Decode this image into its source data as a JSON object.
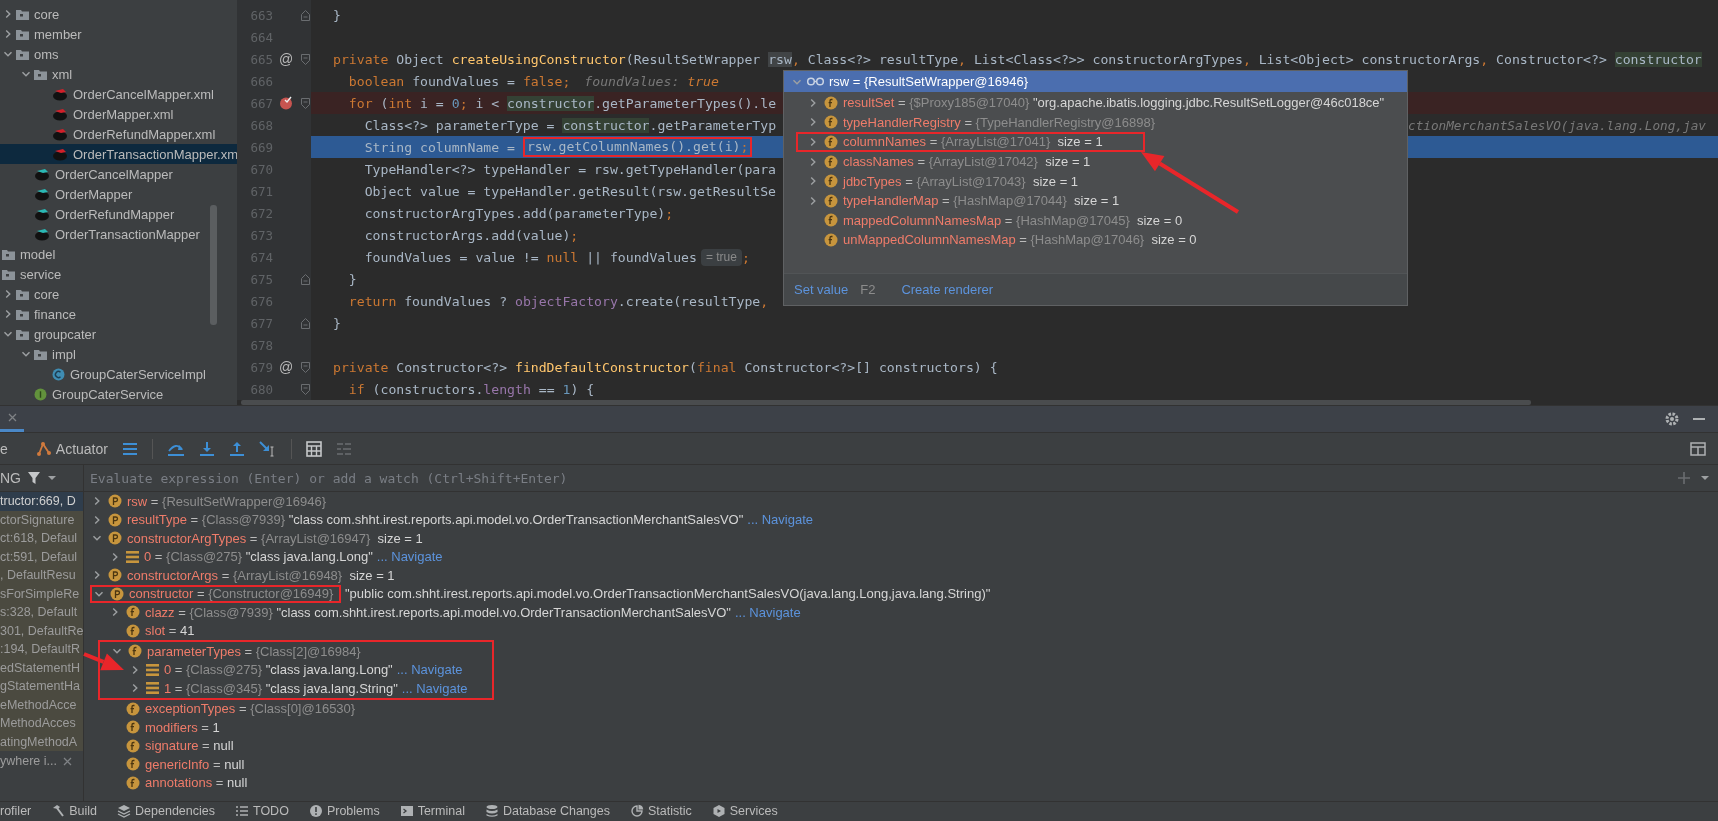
{
  "project_tree": [
    {
      "children": [
        {
          "label": "core",
          "kind": "folder",
          "expanded": false,
          "selected": false
        },
        {
          "label": "member",
          "kind": "folder",
          "expanded": false,
          "selected": false
        },
        {
          "label": "oms",
          "kind": "folder",
          "expanded": true,
          "selected": false,
          "children": [
            {
              "label": "xml",
              "kind": "folder",
              "expanded": true,
              "selected": false,
              "children": [
                {
                  "label": "OrderCancelMapper.xml",
                  "kind": "mapper-xml",
                  "selected": false
                },
                {
                  "label": "OrderMapper.xml",
                  "kind": "mapper-xml",
                  "selected": false
                },
                {
                  "label": "OrderRefundMapper.xml",
                  "kind": "mapper-xml",
                  "selected": false
                },
                {
                  "label": "OrderTransactionMapper.xm",
                  "kind": "mapper-xml",
                  "selected": true
                }
              ]
            },
            {
              "label": "OrderCancelMapper",
              "kind": "mapper",
              "selected": false
            },
            {
              "label": "OrderMapper",
              "kind": "mapper",
              "selected": false
            },
            {
              "label": "OrderRefundMapper",
              "kind": "mapper",
              "selected": false
            },
            {
              "label": "OrderTransactionMapper",
              "kind": "mapper",
              "selected": false
            }
          ]
        }
      ]
    },
    {
      "label": "model",
      "kind": "folder",
      "selected": false
    },
    {
      "label": "service",
      "kind": "folder",
      "selected": false,
      "children": [
        {
          "label": "core",
          "kind": "folder",
          "expanded": false,
          "selected": false
        },
        {
          "label": "finance",
          "kind": "folder",
          "expanded": false,
          "selected": false
        },
        {
          "label": "groupcater",
          "kind": "folder",
          "expanded": true,
          "selected": false,
          "children": [
            {
              "label": "impl",
              "kind": "folder",
              "expanded": true,
              "selected": false,
              "children": [
                {
                  "label": "GroupCaterServiceImpl",
                  "kind": "class",
                  "selected": false
                }
              ]
            },
            {
              "label": "GroupCaterService",
              "kind": "interface",
              "selected": false
            }
          ]
        }
      ]
    }
  ],
  "editor": {
    "lines_before": [
      {
        "number": "663",
        "fold_end": true,
        "tokens": [
          {
            "kind": "plain",
            "text": "}"
          }
        ]
      },
      {
        "number": "664"
      },
      {
        "number": "665",
        "fold_start": true,
        "marker": "@",
        "tokens": [
          {
            "kind": "kw",
            "text": "private "
          },
          {
            "kind": "plain",
            "text": "Object "
          },
          {
            "kind": "decl",
            "text": "createUsingConstructor"
          },
          {
            "kind": "plain",
            "text": "(ResultSetWrapper "
          },
          {
            "kind": "hover",
            "text": "rsw"
          },
          {
            "kind": "kw",
            "text": ","
          },
          {
            "kind": "plain",
            "text": " Class<?> resultType"
          },
          {
            "kind": "kw",
            "text": ","
          },
          {
            "kind": "plain",
            "text": " List<Class<?>> constructorArgTypes"
          },
          {
            "kind": "kw",
            "text": ","
          },
          {
            "kind": "plain",
            "text": " List<Object> constructorArgs"
          },
          {
            "kind": "kw",
            "text": ","
          },
          {
            "kind": "plain",
            "text": " Constructor<?> "
          },
          {
            "kind": "usage",
            "text": "constructor"
          }
        ]
      }
    ],
    "lines_beside_popup": [
      {
        "number": "666",
        "tokens": [
          {
            "kind": "kw",
            "text": "  boolean "
          },
          {
            "kind": "plain",
            "text": "foundValues = "
          },
          {
            "kind": "kw",
            "text": "false;"
          },
          {
            "kind": "hint",
            "text": "foundValues: "
          },
          {
            "kind": "hintval",
            "text": "true"
          }
        ]
      },
      {
        "number": "667",
        "fold_start": true,
        "breakpoint": true,
        "tokens": [
          {
            "kind": "kw",
            "text": "  for "
          },
          {
            "kind": "plain",
            "text": "("
          },
          {
            "kind": "kw",
            "text": "int "
          },
          {
            "kind": "plain",
            "text": "i = "
          },
          {
            "kind": "num",
            "text": "0"
          },
          {
            "kind": "kw",
            "text": "; "
          },
          {
            "kind": "plain",
            "text": "i < "
          },
          {
            "kind": "usage",
            "text": "constructor"
          },
          {
            "kind": "plain",
            "text": ".getParameterTypes().le"
          }
        ]
      },
      {
        "number": "668",
        "tokens": [
          {
            "kind": "plain",
            "text": "    Class<?> parameterType = "
          },
          {
            "kind": "usage",
            "text": "constructor"
          },
          {
            "kind": "plain",
            "text": ".getParameterTyp"
          }
        ],
        "right": [
          {
            "kind": "hint",
            "text": "ctionMerchantSalesVO(java.lang.Long,jav"
          }
        ]
      },
      {
        "number": "669",
        "current": true,
        "tokens": [
          {
            "kind": "plain",
            "text": "    String columnName = "
          },
          {
            "kind": "plain",
            "text": "rsw.getColumnNames().get(i)",
            "boxed": true
          },
          {
            "kind": "kw",
            "text": ";",
            "boxed": true
          }
        ]
      },
      {
        "number": "670",
        "tokens": [
          {
            "kind": "plain",
            "text": "    TypeHandler<?> typeHandler = rsw.getTypeHandler(para"
          }
        ]
      },
      {
        "number": "671",
        "tokens": [
          {
            "kind": "plain",
            "text": "    Object value = typeHandler.getResult(rsw.getResultSe"
          }
        ]
      },
      {
        "number": "672",
        "tokens": [
          {
            "kind": "plain",
            "text": "    constructorArgTypes.add(parameterType)"
          },
          {
            "kind": "kw",
            "text": ";"
          }
        ]
      },
      {
        "number": "673",
        "tokens": [
          {
            "kind": "plain",
            "text": "    constructorArgs.add(value)"
          },
          {
            "kind": "kw",
            "text": ";"
          }
        ]
      },
      {
        "number": "674",
        "tokens": [
          {
            "kind": "plain",
            "text": "    foundValues = value != "
          },
          {
            "kind": "kw",
            "text": "null "
          },
          {
            "kind": "plain",
            "text": "|| foundValues"
          },
          {
            "kind": "chip",
            "text": "= true"
          },
          {
            "kind": "kw",
            "text": ";"
          }
        ]
      },
      {
        "number": "675",
        "fold_end": true,
        "tokens": [
          {
            "kind": "plain",
            "text": "  }"
          }
        ]
      },
      {
        "number": "676",
        "tokens": [
          {
            "kind": "kw",
            "text": "  return "
          },
          {
            "kind": "plain",
            "text": "foundValues ? "
          },
          {
            "kind": "field",
            "text": "objectFactory"
          },
          {
            "kind": "plain",
            "text": ".create(resultType"
          },
          {
            "kind": "kw",
            "text": ","
          }
        ]
      }
    ],
    "lines_after": [
      {
        "number": "677",
        "fold_end": true,
        "tokens": [
          {
            "kind": "plain",
            "text": "}"
          }
        ]
      },
      {
        "number": "678"
      },
      {
        "number": "679",
        "fold_start": true,
        "marker": "@",
        "tokens": [
          {
            "kind": "kw",
            "text": "private "
          },
          {
            "kind": "plain",
            "text": "Constructor<?> "
          },
          {
            "kind": "decl",
            "text": "findDefaultConstructor"
          },
          {
            "kind": "plain",
            "text": "("
          },
          {
            "kind": "kw",
            "text": "final "
          },
          {
            "kind": "plain",
            "text": "Constructor<?>[] constructors) {"
          }
        ]
      },
      {
        "number": "680",
        "fold_start": true,
        "tokens": [
          {
            "kind": "kw",
            "text": "  if "
          },
          {
            "kind": "plain",
            "text": "(constructors."
          },
          {
            "kind": "field",
            "text": "length "
          },
          {
            "kind": "plain",
            "text": "== "
          },
          {
            "kind": "num",
            "text": "1"
          },
          {
            "kind": "plain",
            "text": ") {"
          }
        ]
      }
    ]
  },
  "debug_popup": {
    "header": {
      "expanded": true,
      "text": "rsw = {ResultSetWrapper@16946}"
    },
    "rows": [
      {
        "expanded": false,
        "parts": [
          {
            "kind": "name",
            "text": "resultSet"
          },
          {
            "kind": "op",
            "text": " = "
          },
          {
            "kind": "ref",
            "text": "{$Proxy185@17040}"
          },
          {
            "kind": "value",
            "text": " \"org.apache.ibatis.logging.jdbc.ResultSetLogger@46c018ce\""
          }
        ]
      },
      {
        "expanded": false,
        "parts": [
          {
            "kind": "name",
            "text": "typeHandlerRegistry"
          },
          {
            "kind": "op",
            "text": " = "
          },
          {
            "kind": "ref",
            "text": "{TypeHandlerRegistry@16898}"
          }
        ]
      },
      {
        "expanded": false,
        "boxed": true,
        "parts": [
          {
            "kind": "name",
            "text": "columnNames"
          },
          {
            "kind": "op",
            "text": " = "
          },
          {
            "kind": "ref",
            "text": "{ArrayList@17041}"
          },
          {
            "kind": "value",
            "text": "  size = 1"
          }
        ]
      },
      {
        "expanded": false,
        "parts": [
          {
            "kind": "name",
            "text": "classNames"
          },
          {
            "kind": "op",
            "text": " = "
          },
          {
            "kind": "ref",
            "text": "{ArrayList@17042}"
          },
          {
            "kind": "value",
            "text": "  size = 1"
          }
        ]
      },
      {
        "expanded": false,
        "parts": [
          {
            "kind": "name",
            "text": "jdbcTypes"
          },
          {
            "kind": "op",
            "text": " = "
          },
          {
            "kind": "ref",
            "text": "{ArrayList@17043}"
          },
          {
            "kind": "value",
            "text": "  size = 1"
          }
        ]
      },
      {
        "expanded": false,
        "parts": [
          {
            "kind": "name",
            "text": "typeHandlerMap"
          },
          {
            "kind": "op",
            "text": " = "
          },
          {
            "kind": "ref",
            "text": "{HashMap@17044}"
          },
          {
            "kind": "value",
            "text": "  size = 1"
          }
        ]
      },
      {
        "parts": [
          {
            "kind": "name",
            "text": "mappedColumnNamesMap"
          },
          {
            "kind": "op",
            "text": " = "
          },
          {
            "kind": "ref",
            "text": "{HashMap@17045}"
          },
          {
            "kind": "value",
            "text": "  size = 0"
          }
        ]
      },
      {
        "parts": [
          {
            "kind": "name",
            "text": "unMappedColumnNamesMap"
          },
          {
            "kind": "op",
            "text": " = "
          },
          {
            "kind": "ref",
            "text": "{HashMap@17046}"
          },
          {
            "kind": "value",
            "text": "  size = 0"
          }
        ]
      }
    ],
    "footer": [
      {
        "kind": "link",
        "text": "Set value"
      },
      {
        "kind": "shortcut",
        "text": "F2"
      },
      {
        "kind": "link",
        "text": "Create renderer"
      }
    ]
  },
  "debug_panel": {
    "toolbar": {
      "tab_label": "e",
      "actuator_label": "Actuator"
    },
    "thread_label": "NG",
    "watch_field": {
      "placeholder": "Evaluate expression (Enter) or add a watch (Ctrl+Shift+Enter)"
    },
    "frames": [
      {
        "text": "tructor:669, D",
        "selected": true,
        "library": false
      },
      {
        "text": "ctorSignature",
        "selected": false,
        "library": true
      },
      {
        "text": "ct:618, Defaul",
        "selected": false,
        "library": true
      },
      {
        "text": "ct:591, Defaul",
        "selected": false,
        "library": true
      },
      {
        "text": ", DefaultResu",
        "selected": false,
        "library": true
      },
      {
        "text": "sForSimpleRe",
        "selected": false,
        "library": true
      },
      {
        "text": "s:328, Default",
        "selected": false,
        "library": true
      },
      {
        "text": "301, DefaultRe",
        "selected": false,
        "library": true
      },
      {
        "text": ":194, DefaultR",
        "selected": false,
        "library": true
      },
      {
        "text": "edStatementH",
        "selected": false,
        "library": true
      },
      {
        "text": "gStatementHa",
        "selected": false,
        "library": true
      },
      {
        "text": "eMethodAcce",
        "selected": false,
        "library": true
      },
      {
        "text": "MethodAcces",
        "selected": false,
        "library": true
      },
      {
        "text": "atingMethodA",
        "selected": false,
        "library": true
      }
    ],
    "frames_tip": "ywhere i...",
    "variables": [
      {
        "kind": "parameter",
        "expanded": false,
        "parts": [
          {
            "kind": "name",
            "text": "rsw"
          },
          {
            "kind": "op",
            "text": " = "
          },
          {
            "kind": "ref",
            "text": "{ResultSetWrapper@16946}"
          }
        ]
      },
      {
        "kind": "parameter",
        "expanded": false,
        "parts": [
          {
            "kind": "name",
            "text": "resultType"
          },
          {
            "kind": "op",
            "text": " = "
          },
          {
            "kind": "ref",
            "text": "{Class@7939}"
          },
          {
            "kind": "value",
            "text": " \"class com.shht.irest.reports.api.model.vo.OrderTransactionMerchantSalesVO\""
          }
        ],
        "link": "... Navigate"
      },
      {
        "kind": "parameter",
        "expanded": true,
        "parts": [
          {
            "kind": "name",
            "text": "constructorArgTypes"
          },
          {
            "kind": "op",
            "text": " = "
          },
          {
            "kind": "ref",
            "text": "{ArrayList@16947}"
          },
          {
            "kind": "value",
            "text": "  size = 1"
          }
        ],
        "children": [
          {
            "kind": "element",
            "expanded": false,
            "parts": [
              {
                "kind": "name",
                "text": "0"
              },
              {
                "kind": "op",
                "text": " = "
              },
              {
                "kind": "ref",
                "text": "{Class@275}"
              },
              {
                "kind": "value",
                "text": " \"class java.lang.Long\""
              }
            ],
            "link": "... Navigate"
          }
        ]
      },
      {
        "kind": "parameter",
        "expanded": false,
        "parts": [
          {
            "kind": "name",
            "text": "constructorArgs"
          },
          {
            "kind": "op",
            "text": " = "
          },
          {
            "kind": "ref",
            "text": "{ArrayList@16948}"
          },
          {
            "kind": "value",
            "text": "  size = 1"
          }
        ]
      },
      {
        "kind": "parameter",
        "expanded": true,
        "boxed": true,
        "parts": [
          {
            "kind": "name",
            "text": "constructor"
          },
          {
            "kind": "op",
            "text": " = "
          },
          {
            "kind": "ref",
            "text": "{Constructor@16949}"
          },
          {
            "kind": "value",
            "text": " \"public com.shht.irest.reports.api.model.vo.OrderTransactionMerchantSalesVO(java.lang.Long,java.lang.String)\""
          }
        ],
        "children": [
          {
            "kind": "field",
            "expanded": false,
            "parts": [
              {
                "kind": "name",
                "text": "clazz"
              },
              {
                "kind": "op",
                "text": " = "
              },
              {
                "kind": "ref",
                "text": "{Class@7939}"
              },
              {
                "kind": "value",
                "text": " \"class com.shht.irest.reports.api.model.vo.OrderTransactionMerchantSalesVO\""
              }
            ],
            "link": "... Navigate"
          },
          {
            "kind": "field",
            "parts": [
              {
                "kind": "name",
                "text": "slot"
              },
              {
                "kind": "op",
                "text": " = "
              },
              {
                "kind": "value",
                "text": "41"
              }
            ]
          },
          {
            "kind": "field",
            "expanded": true,
            "boxed": true,
            "parts": [
              {
                "kind": "name",
                "text": "parameterTypes"
              },
              {
                "kind": "op",
                "text": " = "
              },
              {
                "kind": "ref",
                "text": "{Class[2]@16984}"
              }
            ],
            "children": [
              {
                "kind": "element",
                "expanded": false,
                "parts": [
                  {
                    "kind": "name",
                    "text": "0"
                  },
                  {
                    "kind": "op",
                    "text": " = "
                  },
                  {
                    "kind": "ref",
                    "text": "{Class@275}"
                  },
                  {
                    "kind": "value",
                    "text": " \"class java.lang.Long\""
                  }
                ],
                "link": "... Navigate"
              },
              {
                "kind": "element",
                "expanded": false,
                "parts": [
                  {
                    "kind": "name",
                    "text": "1"
                  },
                  {
                    "kind": "op",
                    "text": " = "
                  },
                  {
                    "kind": "ref",
                    "text": "{Class@345}"
                  },
                  {
                    "kind": "value",
                    "text": " \"class java.lang.String\""
                  }
                ],
                "link": "... Navigate"
              }
            ]
          },
          {
            "kind": "field",
            "parts": [
              {
                "kind": "name",
                "text": "exceptionTypes"
              },
              {
                "kind": "op",
                "text": " = "
              },
              {
                "kind": "ref",
                "text": "{Class[0]@16530}"
              }
            ]
          },
          {
            "kind": "field",
            "parts": [
              {
                "kind": "name",
                "text": "modifiers"
              },
              {
                "kind": "op",
                "text": " = "
              },
              {
                "kind": "value",
                "text": "1"
              }
            ]
          },
          {
            "kind": "field",
            "parts": [
              {
                "kind": "name",
                "text": "signature"
              },
              {
                "kind": "op",
                "text": " = "
              },
              {
                "kind": "value",
                "text": "null"
              }
            ]
          },
          {
            "kind": "field",
            "parts": [
              {
                "kind": "name",
                "text": "genericInfo"
              },
              {
                "kind": "op",
                "text": " = "
              },
              {
                "kind": "value",
                "text": "null"
              }
            ]
          },
          {
            "kind": "field",
            "parts": [
              {
                "kind": "name",
                "text": "annotations"
              },
              {
                "kind": "op",
                "text": " = "
              },
              {
                "kind": "value",
                "text": "null"
              }
            ]
          }
        ]
      }
    ]
  },
  "annotation_arrows": [
    {
      "kind": "arrow"
    },
    {
      "kind": "arrow"
    }
  ],
  "tool_window_bar": [
    {
      "kind": "profiler",
      "label": "rofiler"
    },
    {
      "kind": "build",
      "label": "Build"
    },
    {
      "kind": "dependencies",
      "label": "Dependencies"
    },
    {
      "kind": "todo",
      "label": "TODO"
    },
    {
      "kind": "problems",
      "label": "Problems"
    },
    {
      "kind": "terminal",
      "label": "Terminal"
    },
    {
      "kind": "database",
      "label": "Database Changes"
    },
    {
      "kind": "statistic",
      "label": "Statistic"
    },
    {
      "kind": "services",
      "label": "Services"
    }
  ]
}
